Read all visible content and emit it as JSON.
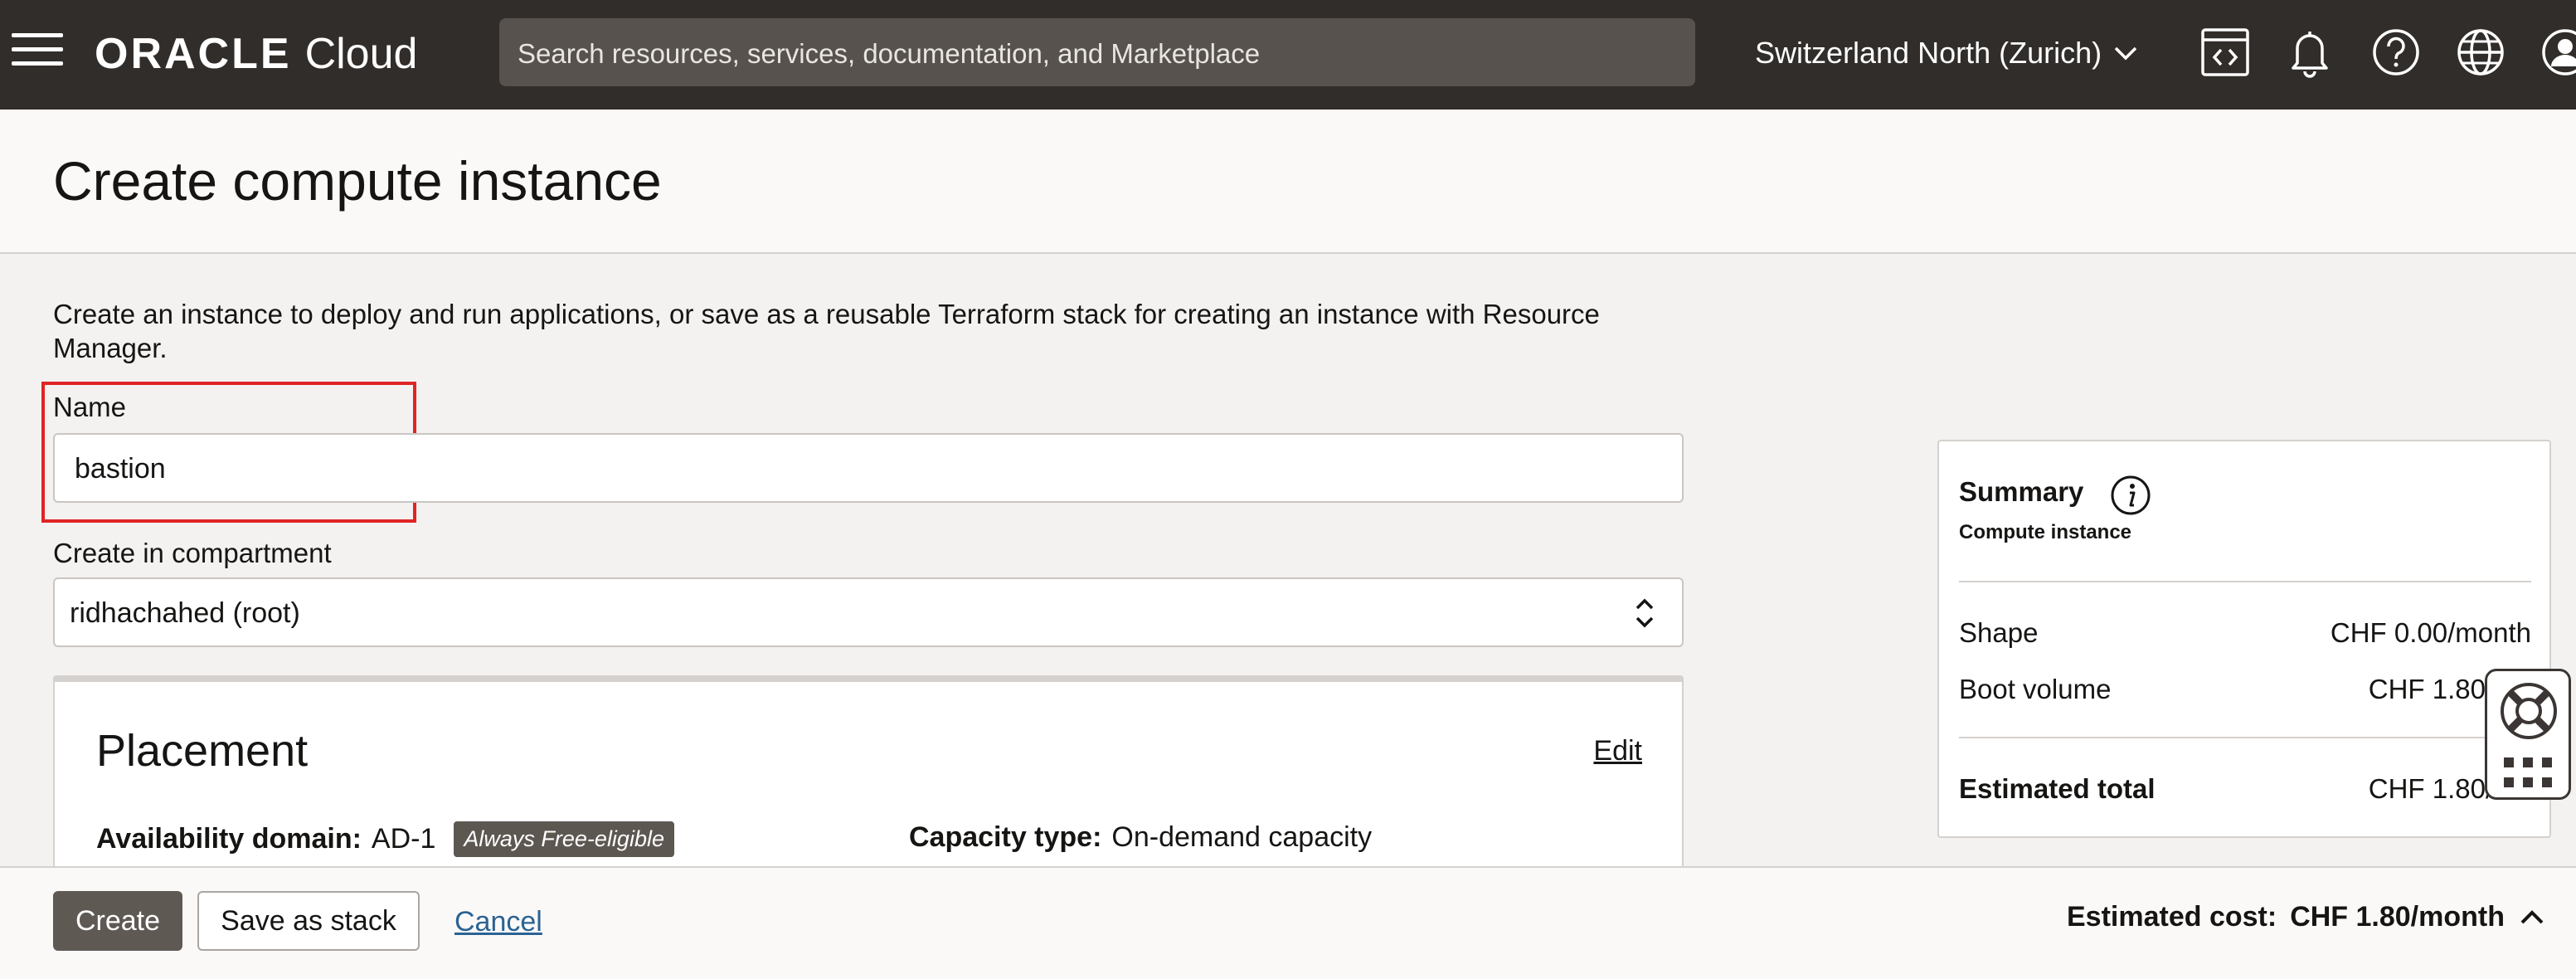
{
  "topbar": {
    "brand": "ORACLE",
    "product": "Cloud",
    "search_placeholder": "Search resources, services, documentation, and Marketplace",
    "region": "Switzerland North (Zurich)",
    "icons": [
      "menu-icon",
      "developer-tools-icon",
      "bell-icon",
      "help-icon",
      "globe-icon",
      "profile-icon"
    ]
  },
  "page": {
    "title": "Create compute instance",
    "intro": "Create an instance to deploy and run applications, or save as a reusable Terraform stack for creating an instance with Resource Manager."
  },
  "form": {
    "name_label": "Name",
    "name_value": "bastion",
    "compartment_label": "Create in compartment",
    "compartment_value": "ridhachahed (root)"
  },
  "placement": {
    "title": "Placement",
    "edit_label": "Edit",
    "ad_label": "Availability domain:",
    "ad_value": "AD-1",
    "ad_badge": "Always Free-eligible",
    "capacity_label": "Capacity type:",
    "capacity_value": "On-demand capacity"
  },
  "summary": {
    "title": "Summary",
    "subtitle": "Compute instance",
    "shape_label": "Shape",
    "shape_value": "CHF 0.00/month",
    "boot_label": "Boot volume",
    "boot_value": "CHF 1.80/mo",
    "total_label": "Estimated total",
    "total_value": "CHF 1.80/mo"
  },
  "footer": {
    "create_label": "Create",
    "save_stack_label": "Save as stack",
    "cancel_label": "Cancel",
    "est_cost_label": "Estimated cost:",
    "est_cost_value": "CHF 1.80/month"
  },
  "colors": {
    "topbar_bg": "#312d2a",
    "search_bg": "#57524e",
    "primary_button": "#5f5954",
    "link": "#2a6393",
    "highlight": "#e02424"
  }
}
